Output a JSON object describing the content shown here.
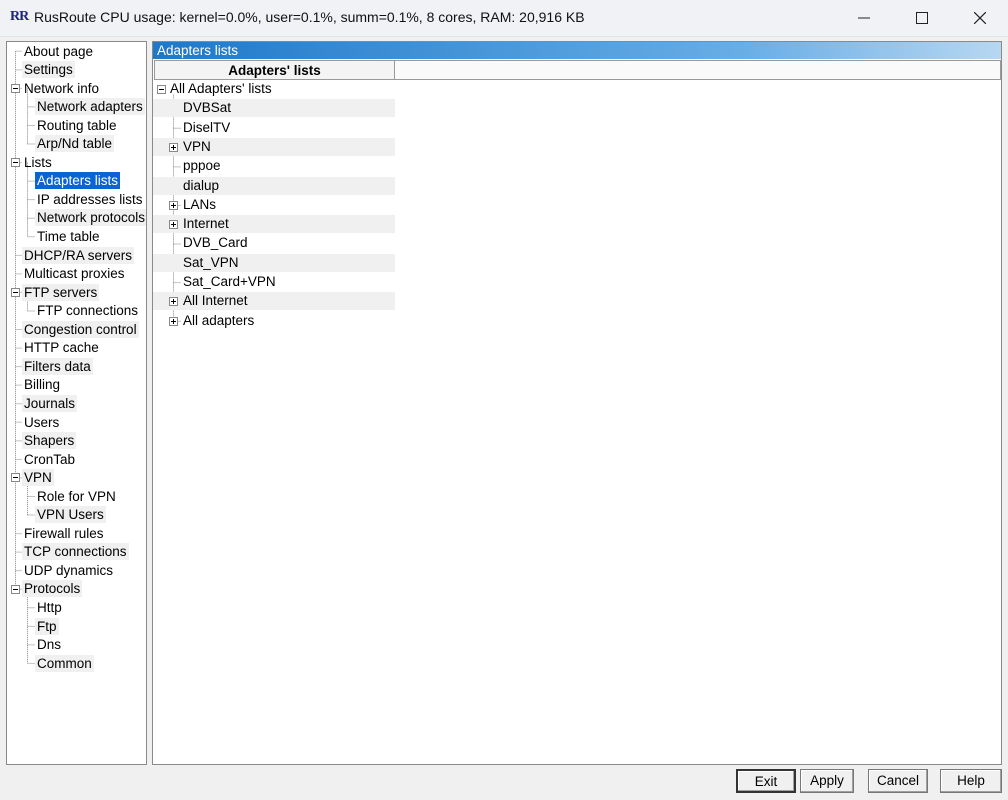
{
  "window": {
    "logo": "RR",
    "title": "RusRoute   CPU usage: kernel=0.0%, user=0.1%, summ=0.1%, 8 cores,  RAM: 20,916 KB"
  },
  "nav_tree": [
    {
      "label": "About page",
      "level": 0
    },
    {
      "label": "Settings",
      "level": 0
    },
    {
      "label": "Network info",
      "level": 0,
      "expander": "minus"
    },
    {
      "label": "Network adapters",
      "level": 1
    },
    {
      "label": "Routing table",
      "level": 1
    },
    {
      "label": "Arp/Nd table",
      "level": 1
    },
    {
      "label": "Lists",
      "level": 0,
      "expander": "minus"
    },
    {
      "label": "Adapters lists",
      "level": 1,
      "selected": true
    },
    {
      "label": "IP addresses lists",
      "level": 1
    },
    {
      "label": "Network protocols",
      "level": 1
    },
    {
      "label": "Time table",
      "level": 1
    },
    {
      "label": "DHCP/RA servers",
      "level": 0
    },
    {
      "label": "Multicast proxies",
      "level": 0
    },
    {
      "label": "FTP servers",
      "level": 0,
      "expander": "minus"
    },
    {
      "label": "FTP connections",
      "level": 1
    },
    {
      "label": "Congestion control",
      "level": 0
    },
    {
      "label": "HTTP cache",
      "level": 0
    },
    {
      "label": "Filters data",
      "level": 0
    },
    {
      "label": "Billing",
      "level": 0
    },
    {
      "label": "Journals",
      "level": 0
    },
    {
      "label": "Users",
      "level": 0
    },
    {
      "label": "Shapers",
      "level": 0
    },
    {
      "label": "CronTab",
      "level": 0
    },
    {
      "label": "VPN",
      "level": 0,
      "expander": "minus"
    },
    {
      "label": "Role for VPN",
      "level": 1
    },
    {
      "label": "VPN Users",
      "level": 1
    },
    {
      "label": "Firewall rules",
      "level": 0
    },
    {
      "label": "TCP connections",
      "level": 0
    },
    {
      "label": "UDP dynamics",
      "level": 0
    },
    {
      "label": "Protocols",
      "level": 0,
      "expander": "minus"
    },
    {
      "label": "Http",
      "level": 1
    },
    {
      "label": "Ftp",
      "level": 1
    },
    {
      "label": "Dns",
      "level": 1
    },
    {
      "label": "Common",
      "level": 1
    }
  ],
  "panel": {
    "title": "Adapters lists",
    "column_header": "Adapters' lists",
    "root": {
      "label": "All Adapters' lists",
      "expander": "minus"
    },
    "items": [
      {
        "label": "DVBSat",
        "expander": null
      },
      {
        "label": "DiselTV",
        "expander": null
      },
      {
        "label": "VPN",
        "expander": "plus"
      },
      {
        "label": "pppoe",
        "expander": null
      },
      {
        "label": "dialup",
        "expander": null
      },
      {
        "label": "LANs",
        "expander": "plus"
      },
      {
        "label": "Internet",
        "expander": "plus"
      },
      {
        "label": "DVB_Card",
        "expander": null
      },
      {
        "label": "Sat_VPN",
        "expander": null
      },
      {
        "label": "Sat_Card+VPN",
        "expander": null
      },
      {
        "label": "All Internet",
        "expander": "plus"
      },
      {
        "label": "All adapters",
        "expander": "plus"
      }
    ]
  },
  "buttons": {
    "exit": "Exit",
    "apply": "Apply",
    "cancel": "Cancel",
    "help": "Help"
  },
  "colors": {
    "selection": "#0a64d4",
    "header_gradient_start": "#1f78c8"
  }
}
